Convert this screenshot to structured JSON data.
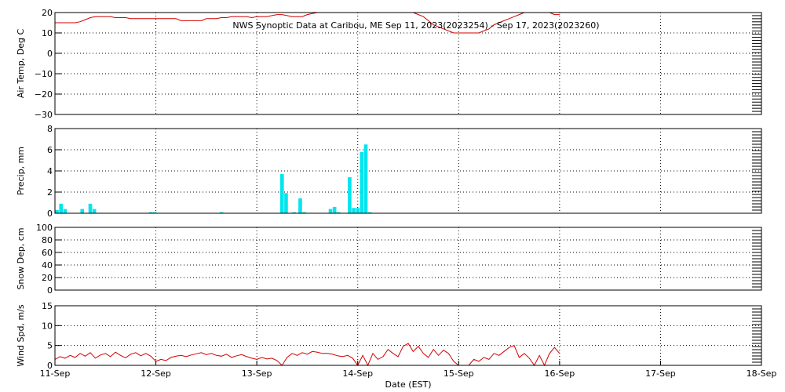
{
  "title": "NWS Synoptic Data at Caribou, ME   Sep 11, 2023(2023254) - Sep 17, 2023(2023260)",
  "xlabel": "Date (EST)",
  "x_ticks": [
    "11-Sep",
    "12-Sep",
    "13-Sep",
    "14-Sep",
    "15-Sep",
    "16-Sep",
    "17-Sep",
    "18-Sep"
  ],
  "colors": {
    "line": "#d40000",
    "bar": "#00e5ee",
    "frame": "#000000",
    "grid": "#000000"
  },
  "chart_data": [
    {
      "type": "line",
      "name": "air-temp",
      "ylabel": "Air Temp, Deg C",
      "ylim": [
        -30,
        20
      ],
      "yticks": [
        20,
        10,
        0,
        -10,
        -20,
        -30
      ],
      "grid": true,
      "x_units": "days since 11-Sep",
      "x": [
        0,
        0.05,
        0.1,
        0.15,
        0.2,
        0.25,
        0.3,
        0.35,
        0.4,
        0.45,
        0.5,
        0.55,
        0.6,
        0.65,
        0.7,
        0.75,
        0.8,
        0.85,
        0.9,
        0.95,
        1.0,
        1.05,
        1.1,
        1.15,
        1.2,
        1.25,
        1.3,
        1.35,
        1.4,
        1.45,
        1.5,
        1.55,
        1.6,
        1.65,
        1.7,
        1.75,
        1.8,
        1.85,
        1.9,
        1.95,
        2.0,
        2.05,
        2.1,
        2.15,
        2.2,
        2.25,
        2.3,
        2.35,
        2.4,
        2.45,
        2.5,
        2.55,
        2.6,
        2.65,
        2.7,
        2.75,
        2.8,
        2.85,
        2.9,
        2.95,
        3.0,
        3.05,
        3.1,
        3.15,
        3.2,
        3.25,
        3.3,
        3.35,
        3.4,
        3.45,
        3.5,
        3.55,
        3.6,
        3.65,
        3.7,
        3.75,
        3.8,
        3.85,
        3.9,
        3.95,
        4.0,
        4.05,
        4.1,
        4.15,
        4.2,
        4.25,
        4.3,
        4.35,
        4.4,
        4.45,
        4.5,
        4.55,
        4.6,
        4.65,
        4.7,
        4.75,
        4.8,
        4.85,
        4.9,
        4.95,
        5.0
      ],
      "y": [
        15,
        15,
        15,
        15,
        15,
        15.5,
        16.5,
        17.5,
        18,
        18,
        18,
        18,
        17.5,
        17.5,
        17.5,
        17,
        17,
        17,
        17,
        17,
        17,
        17,
        17,
        17,
        17,
        16,
        16,
        16,
        16,
        16,
        17,
        17,
        17,
        17.5,
        17.5,
        18,
        18,
        18,
        18,
        17.5,
        18,
        18,
        18,
        18.5,
        19,
        19,
        18.5,
        18,
        18,
        18,
        19,
        19.5,
        20,
        20.5,
        21,
        21,
        21,
        21,
        21,
        21,
        21,
        21,
        21,
        21,
        21,
        21,
        21,
        21,
        21,
        21,
        21,
        20,
        19,
        18,
        16,
        14,
        13,
        12,
        11,
        10,
        10,
        10,
        10,
        10,
        10,
        11,
        12,
        14,
        15,
        16,
        17,
        18,
        19,
        20,
        20,
        20,
        20,
        20,
        20,
        19,
        19,
        18,
        18,
        18,
        18
      ]
    },
    {
      "type": "bar",
      "name": "precip",
      "ylabel": "Precip, mm",
      "ylim": [
        0,
        8
      ],
      "yticks": [
        0,
        2,
        4,
        6,
        8
      ],
      "grid": true,
      "x_units": "days since 11-Sep",
      "x": [
        0.02,
        0.06,
        0.1,
        0.27,
        0.35,
        0.39,
        0.95,
        0.99,
        1.65,
        2.25,
        2.29,
        2.37,
        2.43,
        2.47,
        2.73,
        2.77,
        2.81,
        2.92,
        2.96,
        3.0,
        3.04,
        3.08,
        3.12
      ],
      "values": [
        0.3,
        0.9,
        0.4,
        0.4,
        0.9,
        0.4,
        0.1,
        0.1,
        0.1,
        3.7,
        1.9,
        0.1,
        1.4,
        0.1,
        0.4,
        0.6,
        0.1,
        3.4,
        0.5,
        0.5,
        5.8,
        6.5,
        0.1
      ]
    },
    {
      "type": "line",
      "name": "snow-depth",
      "ylabel": "Snow Dep, cm",
      "ylim": [
        0,
        100
      ],
      "yticks": [
        0,
        20,
        40,
        60,
        80,
        100
      ],
      "grid": true,
      "x": [],
      "y": []
    },
    {
      "type": "line",
      "name": "wind-speed",
      "ylabel": "Wind Spd, m/s",
      "ylim": [
        0,
        15
      ],
      "yticks": [
        0,
        5,
        10,
        15
      ],
      "grid": true,
      "x_units": "days since 11-Sep",
      "x": [
        0,
        0.05,
        0.1,
        0.15,
        0.2,
        0.25,
        0.3,
        0.35,
        0.4,
        0.45,
        0.5,
        0.55,
        0.6,
        0.65,
        0.7,
        0.75,
        0.8,
        0.85,
        0.9,
        0.95,
        1.0,
        1.05,
        1.1,
        1.15,
        1.2,
        1.25,
        1.3,
        1.35,
        1.4,
        1.45,
        1.5,
        1.55,
        1.6,
        1.65,
        1.7,
        1.75,
        1.8,
        1.85,
        1.9,
        1.95,
        2.0,
        2.05,
        2.1,
        2.15,
        2.2,
        2.25,
        2.3,
        2.35,
        2.4,
        2.45,
        2.5,
        2.55,
        2.6,
        2.65,
        2.7,
        2.75,
        2.8,
        2.85,
        2.9,
        2.95,
        3.0,
        3.05,
        3.1,
        3.15,
        3.2,
        3.25,
        3.3,
        3.35,
        3.4,
        3.45,
        3.5,
        3.55,
        3.6,
        3.65,
        3.7,
        3.75,
        3.8,
        3.85,
        3.9,
        3.95,
        4.0,
        4.05,
        4.1,
        4.15,
        4.2,
        4.25,
        4.3,
        4.35,
        4.4,
        4.45,
        4.5,
        4.55,
        4.6,
        4.65,
        4.7,
        4.75,
        4.8,
        4.85,
        4.9,
        4.95,
        5.0
      ],
      "y": [
        1.5,
        2.2,
        1.8,
        2.5,
        2.0,
        3.0,
        2.3,
        3.2,
        1.8,
        2.6,
        3.0,
        2.2,
        3.3,
        2.5,
        1.9,
        2.8,
        3.2,
        2.4,
        3.0,
        2.3,
        1.0,
        1.5,
        1.2,
        2.0,
        2.3,
        2.5,
        2.2,
        2.6,
        2.9,
        3.2,
        2.7,
        3.0,
        2.5,
        2.3,
        2.8,
        2.0,
        2.4,
        2.7,
        2.2,
        1.8,
        1.5,
        2.0,
        1.6,
        1.8,
        1.2,
        0.0,
        2.0,
        3.0,
        2.5,
        3.2,
        2.8,
        3.5,
        3.3,
        3.0,
        3.0,
        2.8,
        2.4,
        2.2,
        2.5,
        1.8,
        0.0,
        2.5,
        0.0,
        3.0,
        1.5,
        2.2,
        4.0,
        3.0,
        2.2,
        4.8,
        5.5,
        3.5,
        4.8,
        3.0,
        2.0,
        4.0,
        2.5,
        3.8,
        3.0,
        1.0,
        0.0,
        0.0,
        0.0,
        1.5,
        1.0,
        2.0,
        1.5,
        3.0,
        2.5,
        3.5,
        4.5,
        5.0,
        2.0,
        3.0,
        1.8,
        0.0,
        2.5,
        0.0,
        3.0,
        4.5,
        3.0
      ]
    }
  ]
}
